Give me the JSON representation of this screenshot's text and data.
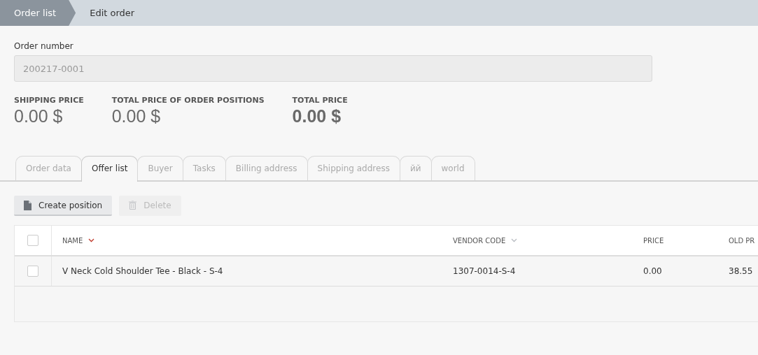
{
  "breadcrumbs": [
    {
      "label": "Order list",
      "selected": true
    },
    {
      "label": "Edit order",
      "selected": false
    }
  ],
  "order_number": {
    "label": "Order number",
    "value": "200217-0001",
    "disabled": true
  },
  "totals": [
    {
      "label": "SHIPPING PRICE",
      "value": "0.00 $",
      "emphasized": false
    },
    {
      "label": "TOTAL PRICE OF ORDER POSITIONS",
      "value": "0.00 $",
      "emphasized": false
    },
    {
      "label": "TOTAL PRICE",
      "value": "0.00 $",
      "emphasized": true
    }
  ],
  "tabs": [
    {
      "label": "Order data",
      "selected": false
    },
    {
      "label": "Offer list",
      "selected": true
    },
    {
      "label": "Buyer",
      "selected": false
    },
    {
      "label": "Tasks",
      "selected": false
    },
    {
      "label": "Billing address",
      "selected": false
    },
    {
      "label": "Shipping address",
      "selected": false
    },
    {
      "label": "йй",
      "selected": false
    },
    {
      "label": "world",
      "selected": false
    }
  ],
  "toolbar": [
    {
      "label": "Create position",
      "kind": "create",
      "disabled": false
    },
    {
      "label": "Delete",
      "kind": "delete",
      "disabled": true
    }
  ],
  "table": {
    "select_all": {
      "checked": false
    },
    "columns": [
      {
        "label": "NAME",
        "sortable": true,
        "sorted": true
      },
      {
        "label": "VENDOR CODE",
        "sortable": true,
        "sorted": false
      },
      {
        "label": "PRICE"
      },
      {
        "label": "OLD PR"
      }
    ],
    "rows": [
      {
        "checked": false,
        "cells": [
          "V Neck Cold Shoulder Tee - Black - S-4",
          "1307-0014-S-4",
          "0.00",
          "38.55"
        ]
      }
    ]
  }
}
